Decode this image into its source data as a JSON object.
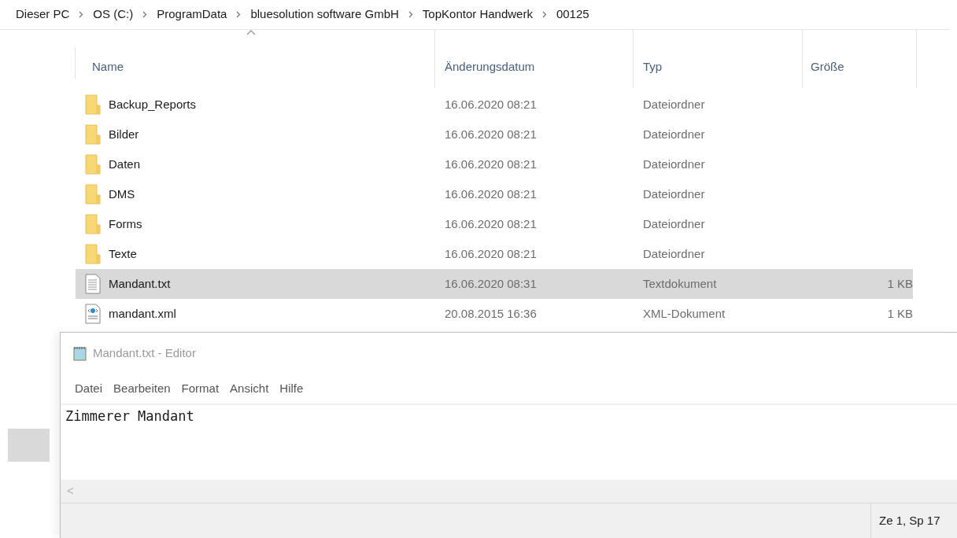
{
  "breadcrumb": [
    "Dieser PC",
    "OS (C:)",
    "ProgramData",
    "bluesolution software GmbH",
    "TopKontor Handwerk",
    "00125"
  ],
  "table": {
    "columns": [
      "Name",
      "Änderungsdatum",
      "Typ",
      "Größe"
    ],
    "rows": [
      {
        "kind": "folder",
        "name": "Backup_Reports",
        "date": "16.06.2020 08:21",
        "type": "Dateiordner",
        "selected": false
      },
      {
        "kind": "folder",
        "name": "Bilder",
        "date": "16.06.2020 08:21",
        "type": "Dateiordner",
        "selected": false
      },
      {
        "kind": "folder",
        "name": "Daten",
        "date": "16.06.2020 08:21",
        "type": "Dateiordner",
        "selected": false
      },
      {
        "kind": "folder",
        "name": "DMS",
        "date": "16.06.2020 08:21",
        "type": "Dateiordner",
        "selected": false
      },
      {
        "kind": "folder",
        "name": "Forms",
        "date": "16.06.2020 08:21",
        "type": "Dateiordner",
        "selected": false
      },
      {
        "kind": "folder",
        "name": "Texte",
        "date": "16.06.2020 08:21",
        "type": "Dateiordner",
        "selected": false
      },
      {
        "kind": "text",
        "name": "Mandant.txt",
        "date": "16.06.2020 08:31",
        "type": "Textdokument",
        "size": "1 KB",
        "selected": true
      },
      {
        "kind": "xml",
        "name": "mandant.xml",
        "date": "20.08.2015 16:36",
        "type": "XML-Dokument",
        "size": "1 KB",
        "selected": false
      }
    ]
  },
  "editor": {
    "title": "Mandant.txt - Editor",
    "menu": [
      "Datei",
      "Bearbeiten",
      "Format",
      "Ansicht",
      "Hilfe"
    ],
    "content": "Zimmerer Mandant",
    "scroll_left": "<",
    "status": "Ze 1, Sp 17"
  }
}
